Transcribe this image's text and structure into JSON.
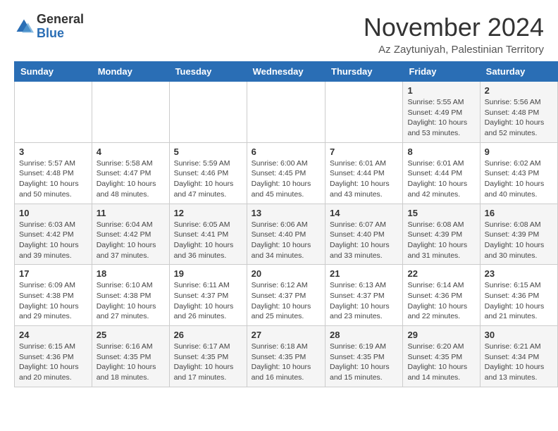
{
  "header": {
    "logo_general": "General",
    "logo_blue": "Blue",
    "month_title": "November 2024",
    "location": "Az Zaytuniyah, Palestinian Territory"
  },
  "weekdays": [
    "Sunday",
    "Monday",
    "Tuesday",
    "Wednesday",
    "Thursday",
    "Friday",
    "Saturday"
  ],
  "weeks": [
    [
      {
        "day": "",
        "info": ""
      },
      {
        "day": "",
        "info": ""
      },
      {
        "day": "",
        "info": ""
      },
      {
        "day": "",
        "info": ""
      },
      {
        "day": "",
        "info": ""
      },
      {
        "day": "1",
        "info": "Sunrise: 5:55 AM\nSunset: 4:49 PM\nDaylight: 10 hours and 53 minutes."
      },
      {
        "day": "2",
        "info": "Sunrise: 5:56 AM\nSunset: 4:48 PM\nDaylight: 10 hours and 52 minutes."
      }
    ],
    [
      {
        "day": "3",
        "info": "Sunrise: 5:57 AM\nSunset: 4:48 PM\nDaylight: 10 hours and 50 minutes."
      },
      {
        "day": "4",
        "info": "Sunrise: 5:58 AM\nSunset: 4:47 PM\nDaylight: 10 hours and 48 minutes."
      },
      {
        "day": "5",
        "info": "Sunrise: 5:59 AM\nSunset: 4:46 PM\nDaylight: 10 hours and 47 minutes."
      },
      {
        "day": "6",
        "info": "Sunrise: 6:00 AM\nSunset: 4:45 PM\nDaylight: 10 hours and 45 minutes."
      },
      {
        "day": "7",
        "info": "Sunrise: 6:01 AM\nSunset: 4:44 PM\nDaylight: 10 hours and 43 minutes."
      },
      {
        "day": "8",
        "info": "Sunrise: 6:01 AM\nSunset: 4:44 PM\nDaylight: 10 hours and 42 minutes."
      },
      {
        "day": "9",
        "info": "Sunrise: 6:02 AM\nSunset: 4:43 PM\nDaylight: 10 hours and 40 minutes."
      }
    ],
    [
      {
        "day": "10",
        "info": "Sunrise: 6:03 AM\nSunset: 4:42 PM\nDaylight: 10 hours and 39 minutes."
      },
      {
        "day": "11",
        "info": "Sunrise: 6:04 AM\nSunset: 4:42 PM\nDaylight: 10 hours and 37 minutes."
      },
      {
        "day": "12",
        "info": "Sunrise: 6:05 AM\nSunset: 4:41 PM\nDaylight: 10 hours and 36 minutes."
      },
      {
        "day": "13",
        "info": "Sunrise: 6:06 AM\nSunset: 4:40 PM\nDaylight: 10 hours and 34 minutes."
      },
      {
        "day": "14",
        "info": "Sunrise: 6:07 AM\nSunset: 4:40 PM\nDaylight: 10 hours and 33 minutes."
      },
      {
        "day": "15",
        "info": "Sunrise: 6:08 AM\nSunset: 4:39 PM\nDaylight: 10 hours and 31 minutes."
      },
      {
        "day": "16",
        "info": "Sunrise: 6:08 AM\nSunset: 4:39 PM\nDaylight: 10 hours and 30 minutes."
      }
    ],
    [
      {
        "day": "17",
        "info": "Sunrise: 6:09 AM\nSunset: 4:38 PM\nDaylight: 10 hours and 29 minutes."
      },
      {
        "day": "18",
        "info": "Sunrise: 6:10 AM\nSunset: 4:38 PM\nDaylight: 10 hours and 27 minutes."
      },
      {
        "day": "19",
        "info": "Sunrise: 6:11 AM\nSunset: 4:37 PM\nDaylight: 10 hours and 26 minutes."
      },
      {
        "day": "20",
        "info": "Sunrise: 6:12 AM\nSunset: 4:37 PM\nDaylight: 10 hours and 25 minutes."
      },
      {
        "day": "21",
        "info": "Sunrise: 6:13 AM\nSunset: 4:37 PM\nDaylight: 10 hours and 23 minutes."
      },
      {
        "day": "22",
        "info": "Sunrise: 6:14 AM\nSunset: 4:36 PM\nDaylight: 10 hours and 22 minutes."
      },
      {
        "day": "23",
        "info": "Sunrise: 6:15 AM\nSunset: 4:36 PM\nDaylight: 10 hours and 21 minutes."
      }
    ],
    [
      {
        "day": "24",
        "info": "Sunrise: 6:15 AM\nSunset: 4:36 PM\nDaylight: 10 hours and 20 minutes."
      },
      {
        "day": "25",
        "info": "Sunrise: 6:16 AM\nSunset: 4:35 PM\nDaylight: 10 hours and 18 minutes."
      },
      {
        "day": "26",
        "info": "Sunrise: 6:17 AM\nSunset: 4:35 PM\nDaylight: 10 hours and 17 minutes."
      },
      {
        "day": "27",
        "info": "Sunrise: 6:18 AM\nSunset: 4:35 PM\nDaylight: 10 hours and 16 minutes."
      },
      {
        "day": "28",
        "info": "Sunrise: 6:19 AM\nSunset: 4:35 PM\nDaylight: 10 hours and 15 minutes."
      },
      {
        "day": "29",
        "info": "Sunrise: 6:20 AM\nSunset: 4:35 PM\nDaylight: 10 hours and 14 minutes."
      },
      {
        "day": "30",
        "info": "Sunrise: 6:21 AM\nSunset: 4:34 PM\nDaylight: 10 hours and 13 minutes."
      }
    ]
  ]
}
